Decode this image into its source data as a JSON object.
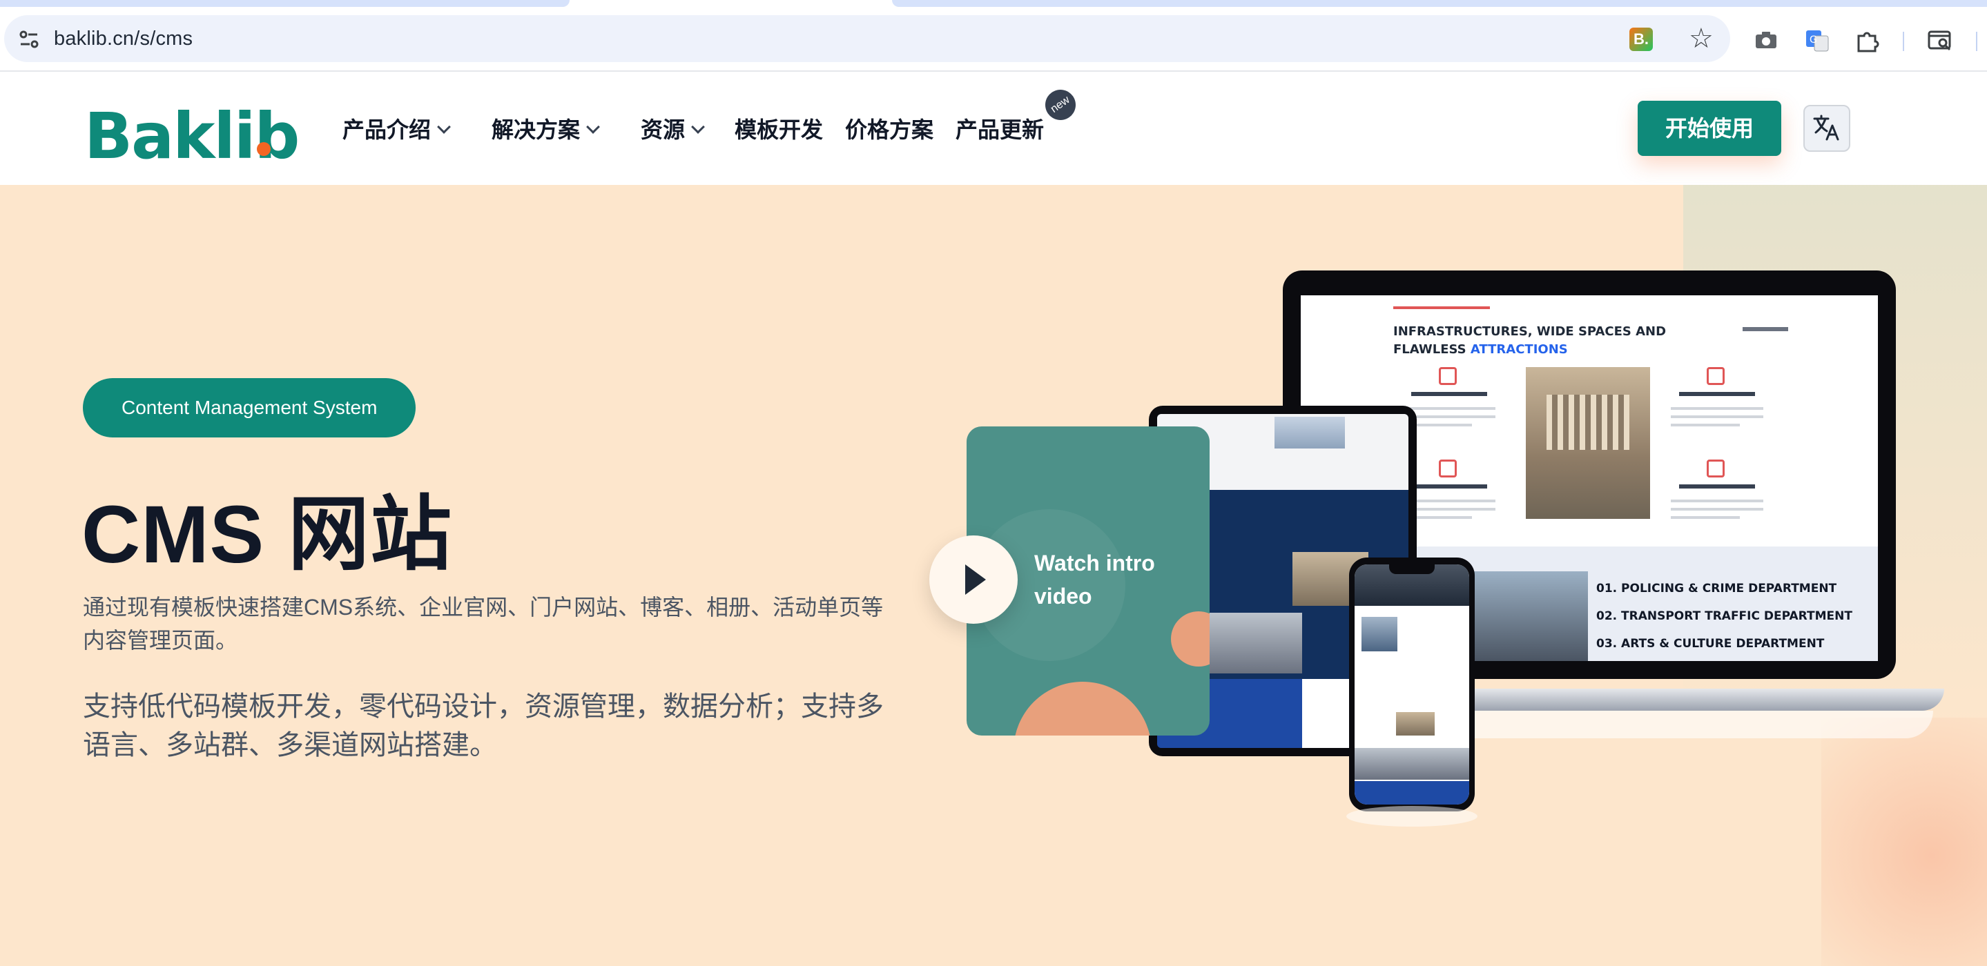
{
  "browser": {
    "url": "baklib.cn/s/cms",
    "extension_letter": "B."
  },
  "header": {
    "logo_text": "Baklib",
    "nav": [
      {
        "label": "产品介绍",
        "dropdown": true
      },
      {
        "label": "解决方案",
        "dropdown": true
      },
      {
        "label": "资源",
        "dropdown": true
      },
      {
        "label": "模板开发",
        "dropdown": false
      },
      {
        "label": "价格方案",
        "dropdown": false
      },
      {
        "label": "产品更新",
        "dropdown": false
      }
    ],
    "new_badge": "new",
    "cta_label": "开始使用",
    "lang_icon": "translate-icon"
  },
  "hero": {
    "pill_label": "Content Management System",
    "title": "CMS 网站",
    "description": "通过现有模板快速搭建CMS系统、企业官网、门户网站、博客、相册、活动单页等内容管理页面。",
    "description2": "支持低代码模板开发，零代码设计，资源管理，数据分析；支持多语言、多站群、多渠道网站搭建。",
    "watch_video_label": "Watch intro video"
  },
  "mockup": {
    "laptop_title_prefix": "INFRASTRUCTURES, WIDE SPACES AND",
    "laptop_title_line2": "FLAWLESS",
    "laptop_title_highlight": "ATTRACTIONS",
    "departments": [
      "01. POLICING & CRIME DEPARTMENT",
      "02. TRANSPORT TRAFFIC DEPARTMENT",
      "03. ARTS & CULTURE DEPARTMENT"
    ]
  },
  "colors": {
    "brand": "#0f8a7a",
    "accent_dot": "#f26522",
    "hero_bg": "#fde6cc",
    "video_card": "#4d9189"
  }
}
